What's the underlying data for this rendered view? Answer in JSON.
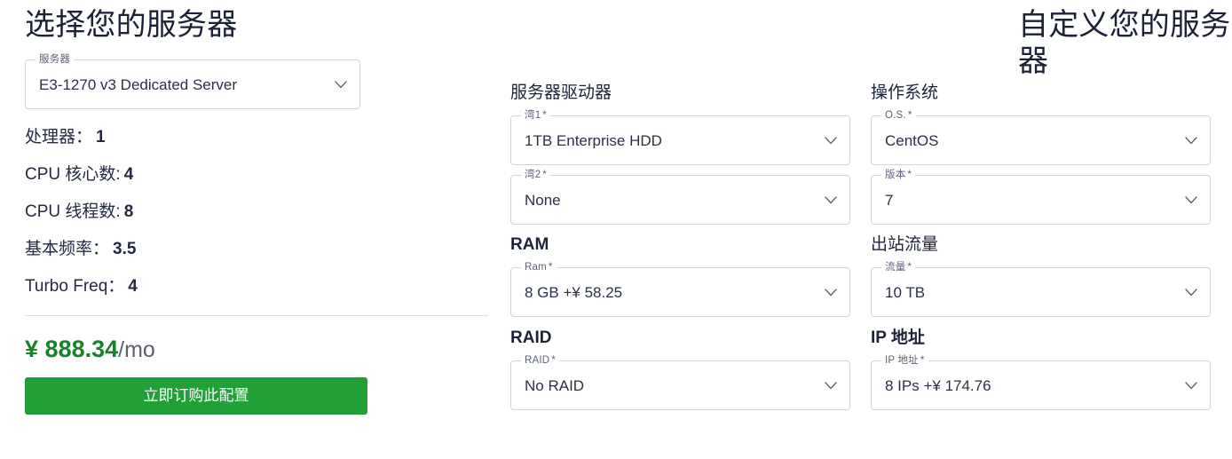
{
  "left": {
    "heading": "选择您的服务器",
    "server_select": {
      "label": "服务器",
      "value": "E3-1270 v3 Dedicated Server"
    },
    "specs": [
      {
        "label": "处理器：",
        "value": "1"
      },
      {
        "label": "CPU 核心数:",
        "value": "4"
      },
      {
        "label": "CPU 线程数:",
        "value": "8"
      },
      {
        "label": "基本频率：",
        "value": "3.5"
      },
      {
        "label": "Turbo Freq：",
        "value": "4"
      }
    ],
    "price": {
      "currency": "¥",
      "amount": "888.34",
      "period": "/mo"
    },
    "order_button": "立即订购此配置"
  },
  "right": {
    "heading": "自定义您的服务器",
    "sections": [
      {
        "title": "服务器驱动器",
        "bold": false,
        "fields": [
          {
            "label": "湾1",
            "required": "*",
            "value": "1TB Enterprise HDD"
          },
          {
            "label": "湾2",
            "required": "*",
            "value": "None"
          }
        ]
      },
      {
        "title": "操作系统",
        "bold": false,
        "fields": [
          {
            "label": "O.S.",
            "required": "*",
            "value": "CentOS"
          },
          {
            "label": "版本",
            "required": "*",
            "value": "7"
          }
        ]
      },
      {
        "title": "RAM",
        "bold": true,
        "fields": [
          {
            "label": "Ram",
            "required": "*",
            "value": "8 GB +¥ 58.25"
          }
        ]
      },
      {
        "title": "出站流量",
        "bold": false,
        "fields": [
          {
            "label": "流量",
            "required": "*",
            "value": "10 TB"
          }
        ]
      },
      {
        "title": "RAID",
        "bold": true,
        "fields": [
          {
            "label": "RAID",
            "required": "*",
            "value": "No RAID"
          }
        ]
      },
      {
        "title": "IP 地址",
        "bold": false,
        "fields": [
          {
            "label": "IP 地址",
            "required": "*",
            "value": "8 IPs +¥ 174.76"
          }
        ]
      }
    ]
  },
  "icons": {
    "chevron_down": "chevron-down-icon"
  },
  "colors": {
    "accent_green": "#21a038",
    "price_green": "#17822b",
    "heading": "#1b2236",
    "border": "#d2d5dc"
  }
}
